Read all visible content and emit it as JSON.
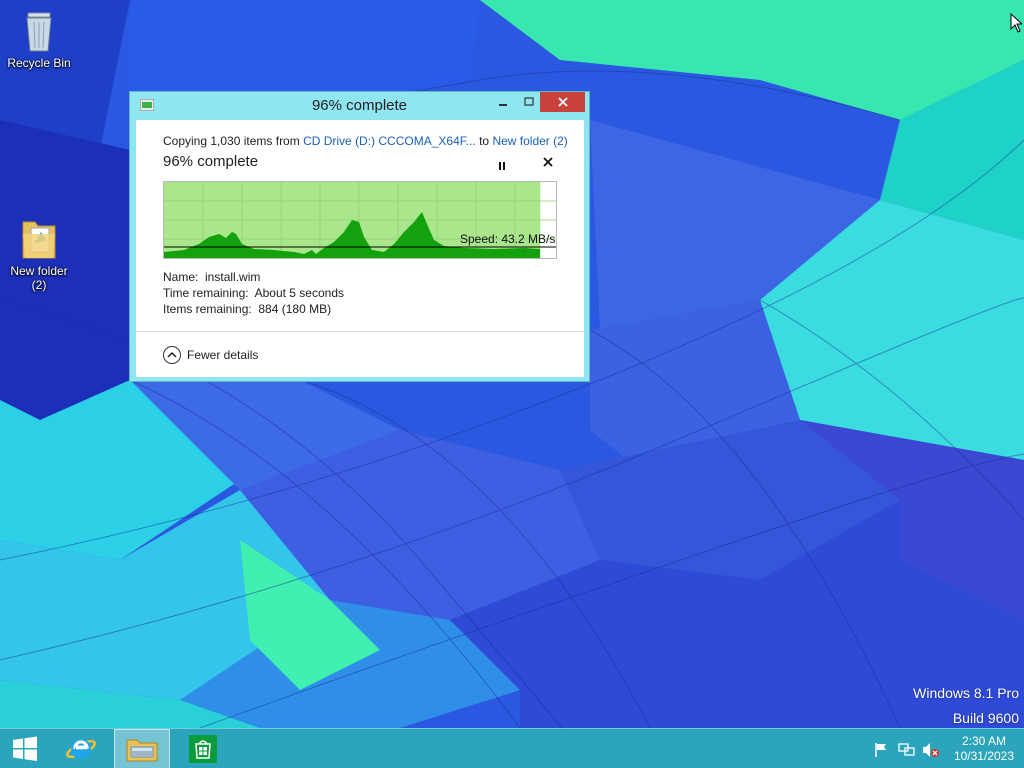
{
  "desktop": {
    "icons": [
      {
        "label": "Recycle Bin"
      },
      {
        "label_line1": "New folder",
        "label_line2": "(2)"
      }
    ],
    "watermark": {
      "line1": "Windows 8.1 Pro",
      "line2": "Build 9600"
    }
  },
  "dialog": {
    "title": "96% complete",
    "copy_prefix": "Copying 1,030 items from ",
    "source": "CD Drive (D:) CCCOMA_X64F...",
    "copy_to": " to ",
    "destination": "New folder (2)",
    "heading": "96% complete",
    "progress_percent": 96,
    "speed_label": "Speed: 43.2 MB/s",
    "name_label": "Name:",
    "name_value": "install.wim",
    "time_label": "Time remaining:",
    "time_value": "About 5 seconds",
    "items_label": "Items remaining:",
    "items_value": "884 (180 MB)",
    "fewer_details": "Fewer details",
    "colors": {
      "graph_fill": "#13a10e",
      "graph_bg": "#a9e68c"
    }
  },
  "taskbar": {
    "clock_time": "2:30 AM",
    "clock_date": "10/31/2023"
  }
}
